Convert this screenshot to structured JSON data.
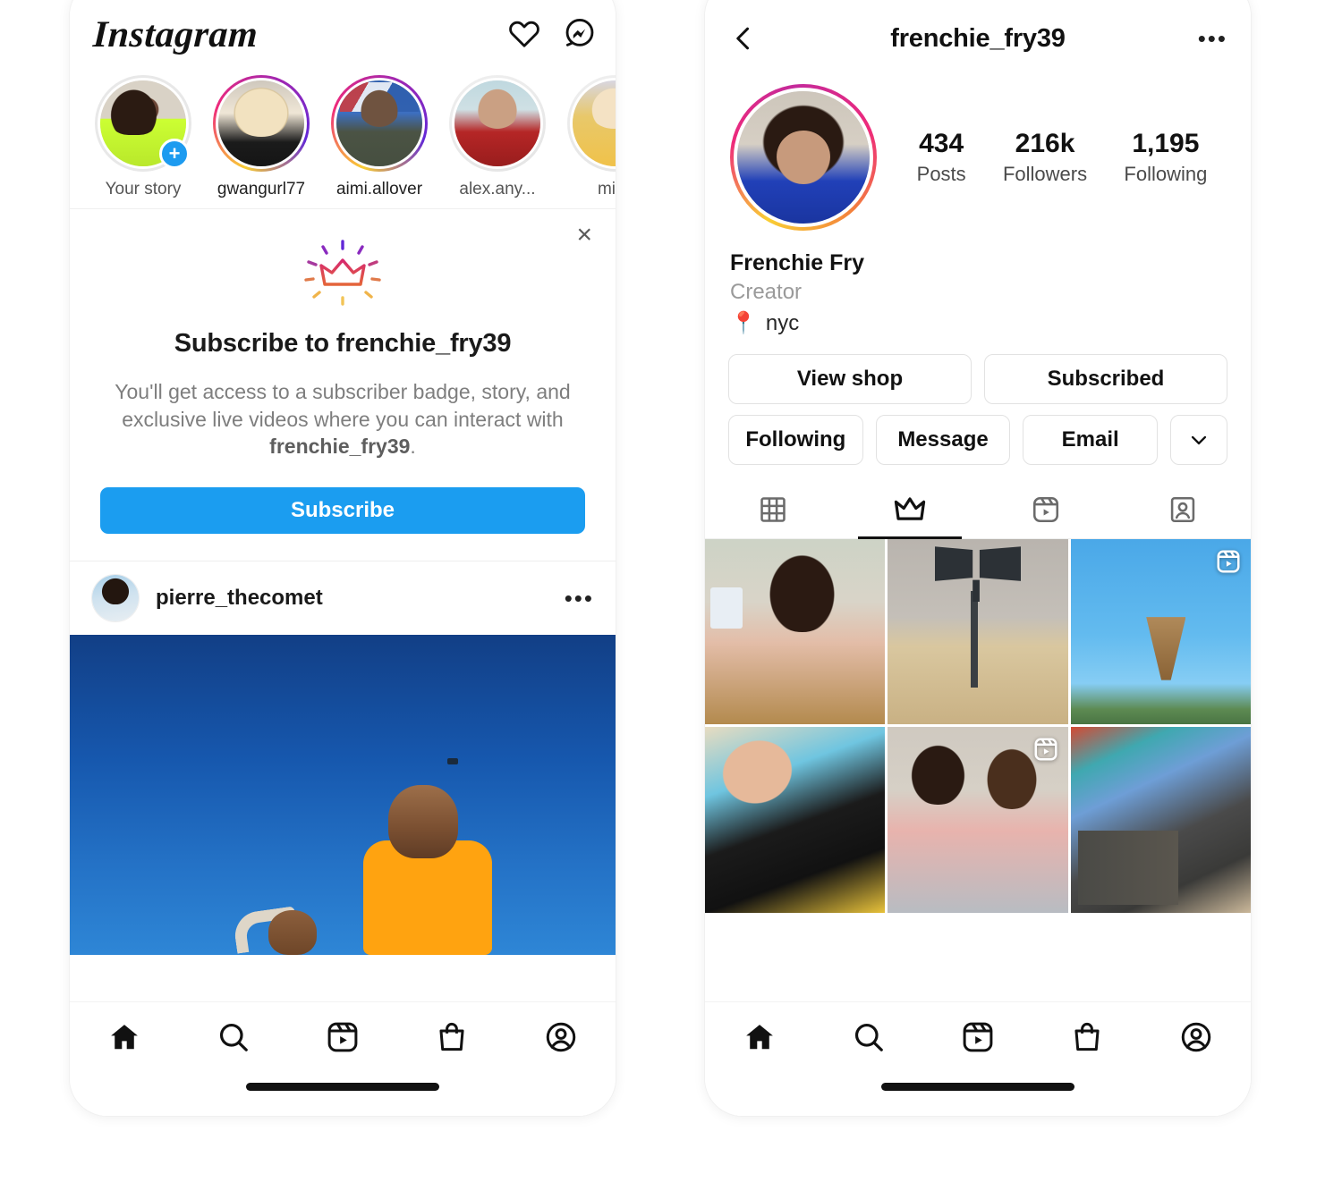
{
  "left_phone": {
    "header": {
      "logo": "Instagram",
      "icons": [
        {
          "name": "heart-icon",
          "label": "Activity"
        },
        {
          "name": "messenger-icon",
          "label": "Messenger"
        }
      ]
    },
    "stories": [
      {
        "name": "Your story",
        "ring": "none",
        "has_add_badge": true
      },
      {
        "name": "gwangurl77",
        "ring": "gradient",
        "has_add_badge": false
      },
      {
        "name": "aimi.allover",
        "ring": "gradient",
        "has_add_badge": false
      },
      {
        "name": "alex.any...",
        "ring": "seen",
        "has_add_badge": false
      },
      {
        "name": "mish",
        "ring": "seen",
        "has_add_badge": false
      }
    ],
    "subscribe_card": {
      "close_label": "×",
      "icon": "crown-sparkle-icon",
      "title": "Subscribe to frenchie_fry39",
      "description_part1": "You'll get access to a subscriber badge, story, and exclusive live videos where you can interact with ",
      "description_strong": "frenchie_fry39",
      "description_part2": ".",
      "button_label": "Subscribe",
      "button_color": "#1b9df0"
    },
    "post": {
      "username": "pierre_thecomet",
      "more_label": "•••",
      "image_alt": "Person in orange hoodie against blue sky"
    },
    "tabbar": [
      {
        "name": "home-icon",
        "label": "Home",
        "active": true
      },
      {
        "name": "search-icon",
        "label": "Search",
        "active": false
      },
      {
        "name": "reels-icon",
        "label": "Reels",
        "active": false
      },
      {
        "name": "shop-icon",
        "label": "Shop",
        "active": false
      },
      {
        "name": "profile-icon",
        "label": "Profile",
        "active": false
      }
    ]
  },
  "right_phone": {
    "header": {
      "back_label": "Back",
      "title": "frenchie_fry39",
      "more_label": "•••"
    },
    "stats": [
      {
        "number": "434",
        "label": "Posts"
      },
      {
        "number": "216k",
        "label": "Followers"
      },
      {
        "number": "1,195",
        "label": "Following"
      }
    ],
    "bio": {
      "name": "Frenchie Fry",
      "category": "Creator",
      "location": "nyc",
      "location_icon": "📍"
    },
    "action_buttons_row1": [
      {
        "label": "View shop",
        "name": "view-shop-button"
      },
      {
        "label": "Subscribed",
        "name": "subscribed-button"
      }
    ],
    "action_buttons_row2": [
      {
        "label": "Following",
        "name": "following-button"
      },
      {
        "label": "Message",
        "name": "message-button"
      },
      {
        "label": "Email",
        "name": "email-button"
      }
    ],
    "chevron_button": {
      "name": "chevron-down-button",
      "label": "More options"
    },
    "profile_tabs": [
      {
        "name": "grid-tab",
        "icon": "grid-icon",
        "active": false
      },
      {
        "name": "subscriber-tab",
        "icon": "crown-icon",
        "active": true
      },
      {
        "name": "reels-tab",
        "icon": "reels-icon",
        "active": false
      },
      {
        "name": "tagged-tab",
        "icon": "tagged-icon",
        "active": false
      }
    ],
    "grid_items": [
      {
        "id": "cell-1",
        "is_reel": false
      },
      {
        "id": "cell-2",
        "is_reel": false
      },
      {
        "id": "cell-3",
        "is_reel": true
      },
      {
        "id": "cell-4",
        "is_reel": false
      },
      {
        "id": "cell-5",
        "is_reel": true
      },
      {
        "id": "cell-6",
        "is_reel": false
      }
    ],
    "tabbar": [
      {
        "name": "home-icon",
        "label": "Home",
        "active": true
      },
      {
        "name": "search-icon",
        "label": "Search",
        "active": false
      },
      {
        "name": "reels-icon",
        "label": "Reels",
        "active": false
      },
      {
        "name": "shop-icon",
        "label": "Shop",
        "active": false
      },
      {
        "name": "profile-icon",
        "label": "Profile",
        "active": false
      }
    ]
  },
  "colors": {
    "accent_blue": "#1b9df0",
    "text_primary": "#111111",
    "text_secondary": "#8e8e8e",
    "border": "#e2e2e2"
  }
}
